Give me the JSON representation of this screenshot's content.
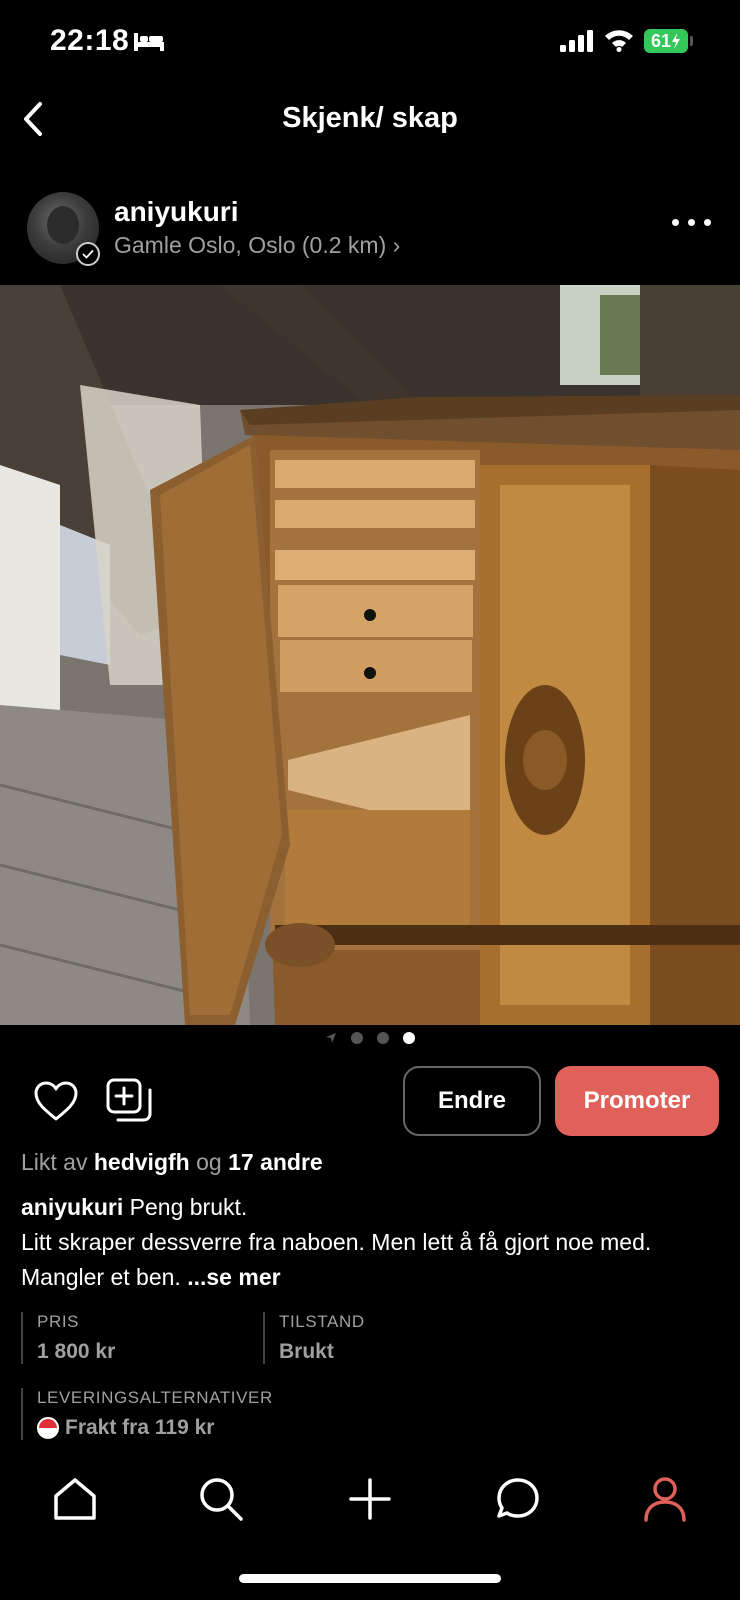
{
  "status_bar": {
    "time": "22:18",
    "battery": "61"
  },
  "header": {
    "title": "Skjenk/ skap"
  },
  "seller": {
    "username": "aniyukuri",
    "location": "Gamle Oslo, Oslo (0.2 km) ›"
  },
  "carousel": {
    "total": 3,
    "active": 3
  },
  "buttons": {
    "edit": "Endre",
    "promote": "Promoter"
  },
  "likes": {
    "prefix": "Likt av",
    "user": "hedvigfh",
    "joiner": "og",
    "others": "17 andre"
  },
  "description": {
    "author": "aniyukuri",
    "first": "Peng brukt.",
    "rest": "Litt skraper dessverre fra naboen. Men lett å få gjort noe med. Mangler et ben.",
    "more": "...se mer"
  },
  "details": {
    "price_label": "PRIS",
    "price": "1 800 kr",
    "condition_label": "TILSTAND",
    "condition": "Brukt",
    "delivery_label": "LEVERINGSALTERNATIVER",
    "delivery": "Frakt fra 119 kr"
  },
  "colors": {
    "accent": "#e0605a",
    "battery": "#34c759",
    "muted": "#a0a0a0"
  },
  "icons": [
    "bed-icon",
    "signal-icon",
    "wifi-icon",
    "back-icon",
    "more-icon",
    "heart-icon",
    "add-collection-icon",
    "home-icon",
    "search-icon",
    "plus-icon",
    "chat-icon",
    "profile-icon"
  ]
}
